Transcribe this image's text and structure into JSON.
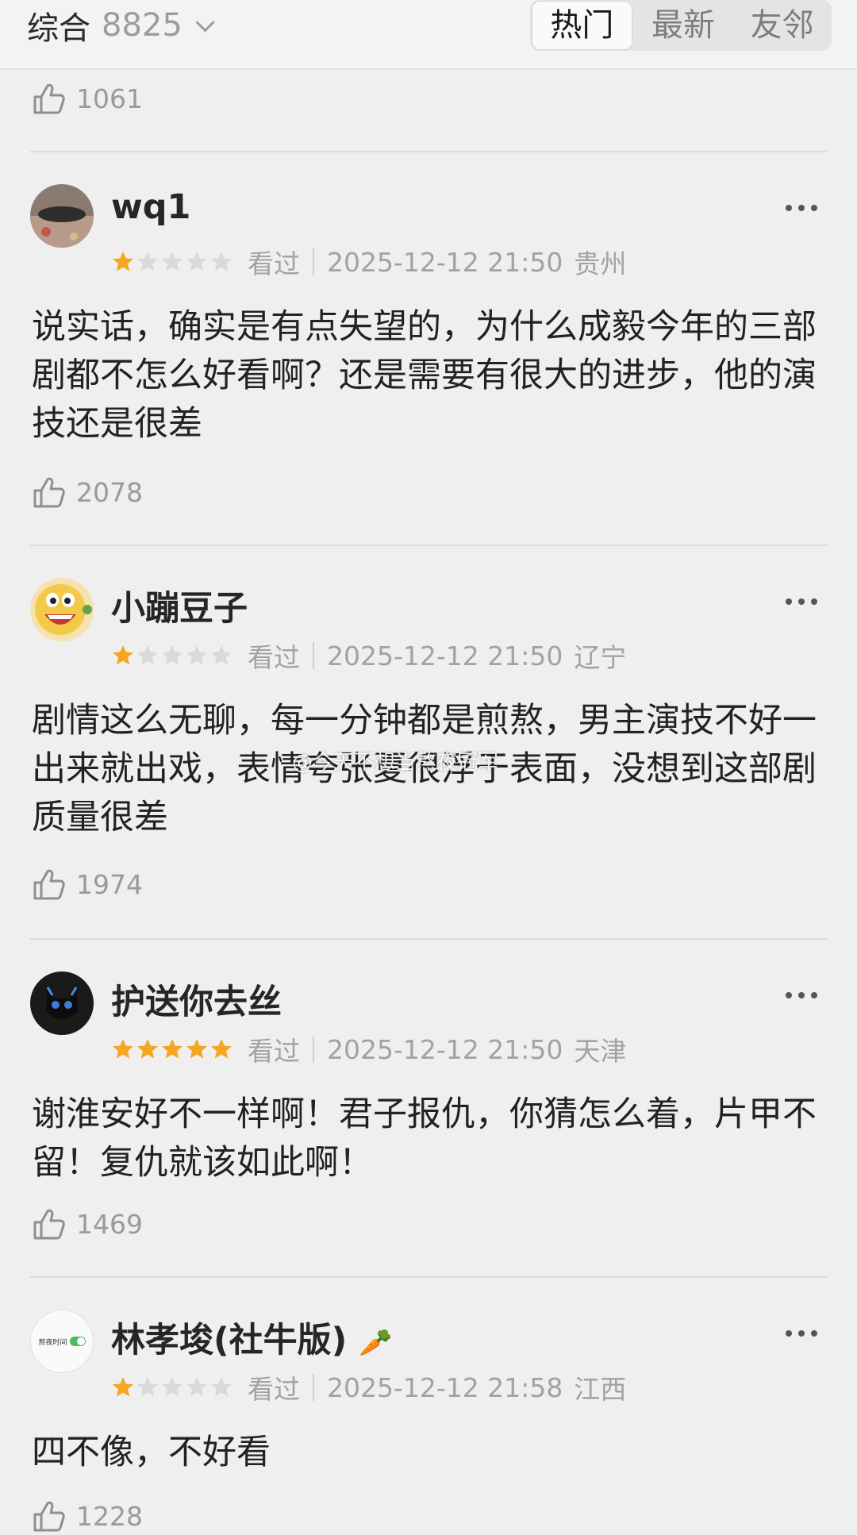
{
  "header": {
    "sort_label": "综合",
    "count": "8825",
    "tabs": [
      "热门",
      "最新",
      "友邻"
    ]
  },
  "top_like": {
    "count": "1061"
  },
  "comments": [
    {
      "name": "wq1",
      "rating": 1,
      "status": "看过",
      "time": "2025-12-12 21:50",
      "location": "贵州",
      "text": "说实话，确实是有点失望的，为什么成毅今年的三部剧都不怎么好看啊？还是需要有很大的进步，他的演技还是很差",
      "likes": "2078",
      "avatar_icon": "photo-avatar"
    },
    {
      "name": "小蹦豆子",
      "rating": 1,
      "status": "看过",
      "time": "2025-12-12 21:50",
      "location": "辽宁",
      "text": "剧情这么无聊，每一分钟都是煎熬，男主演技不好一出来就出戏，表情夸张夏很浮于表面，没想到这部剧质量很差",
      "likes": "1974",
      "avatar_icon": "cartoon-face-avatar"
    },
    {
      "name": "护送你去丝",
      "rating": 5,
      "status": "看过",
      "time": "2025-12-12 21:50",
      "location": "天津",
      "text": "谢淮安好不一样啊！君子报仇，你猜怎么着，片甲不留！复仇就该如此啊！",
      "likes": "1469",
      "avatar_icon": "black-cat-avatar"
    },
    {
      "name": "林孝埈(社牛版)",
      "badge": "🥕",
      "rating": 1,
      "status": "看过",
      "time": "2025-12-12 21:58",
      "location": "江西",
      "text": "四不像，不好看",
      "likes": "1228",
      "avatar_icon": "toggle-avatar",
      "avatar_text": "熬夜时间"
    }
  ],
  "watermark": "@今天不想当熬夜冠军",
  "colors": {
    "star": "#f5a623",
    "star_empty": "#d9d9d9",
    "muted": "#a2a2a2"
  }
}
